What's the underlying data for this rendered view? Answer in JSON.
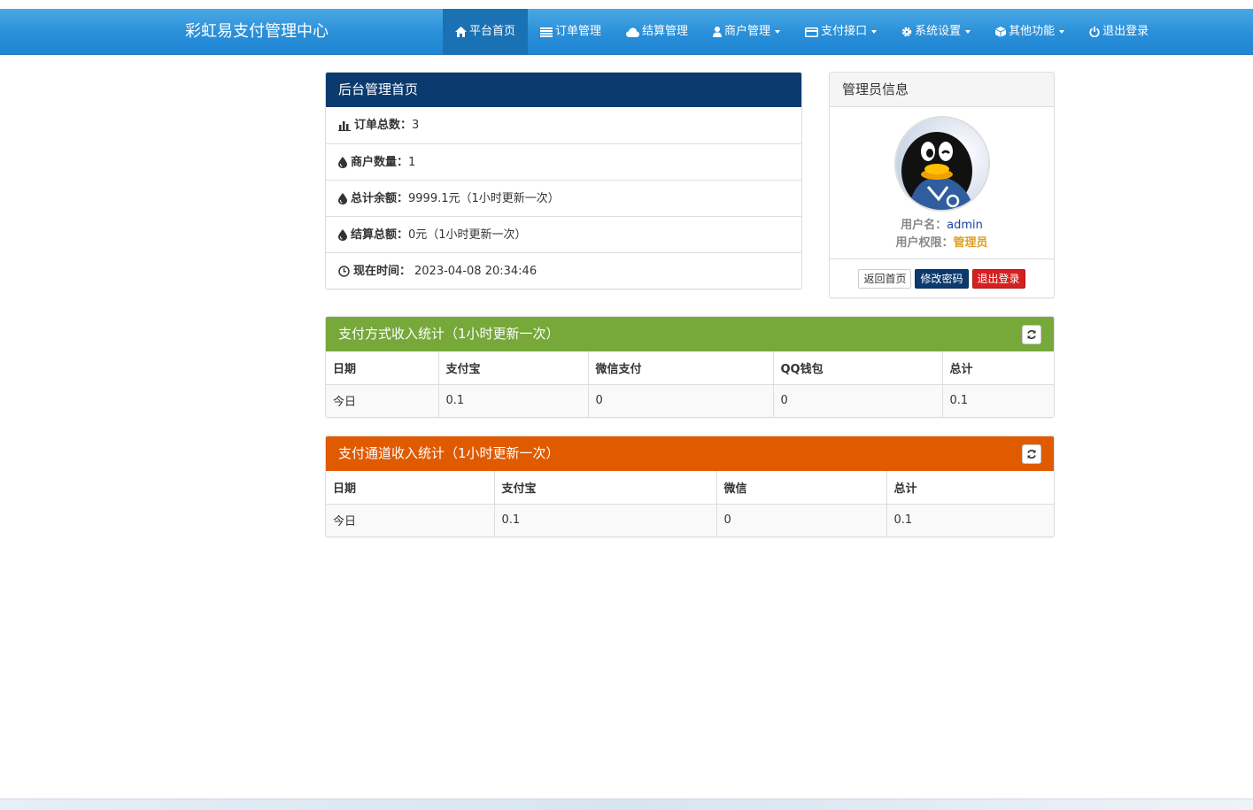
{
  "brand": "彩虹易支付管理中心",
  "nav": {
    "home": "平台首页",
    "orders": "订单管理",
    "settlement": "结算管理",
    "merchants": "商户管理",
    "payment": "支付接口",
    "system": "系统设置",
    "other": "其他功能",
    "logout": "退出登录"
  },
  "dashboard": {
    "title": "后台管理首页",
    "order_total_label": "订单总数：",
    "order_total": "3",
    "merchant_count_label": "商户数量：",
    "merchant_count": "1",
    "balance_label": "总计余额：",
    "balance": "9999.1元（1小时更新一次）",
    "settle_label": "结算总额：",
    "settle": "0元（1小时更新一次）",
    "time_label": "现在时间：",
    "time": "2023-04-08 20:34:46"
  },
  "admin": {
    "title": "管理员信息",
    "username_label": "用户名：",
    "username": "admin",
    "role_label": "用户权限：",
    "role": "管理员",
    "btn_home": "返回首页",
    "btn_password": "修改密码",
    "btn_logout": "退出登录"
  },
  "method_stats": {
    "title": "支付方式收入统计（1小时更新一次）",
    "headers": [
      "日期",
      "支付宝",
      "微信支付",
      "QQ钱包",
      "总计"
    ],
    "rows": [
      [
        "今日",
        "0.1",
        "0",
        "0",
        "0.1"
      ]
    ]
  },
  "channel_stats": {
    "title": "支付通道收入统计（1小时更新一次）",
    "headers": [
      "日期",
      "支付宝",
      "微信",
      "总计"
    ],
    "rows": [
      [
        "今日",
        "0.1",
        "0",
        "0.1"
      ]
    ]
  },
  "colors": {
    "navbar": "#2a8fd8",
    "dashboard_head": "#0a3a6e",
    "method_head": "#76a83a",
    "channel_head": "#e05a00"
  }
}
